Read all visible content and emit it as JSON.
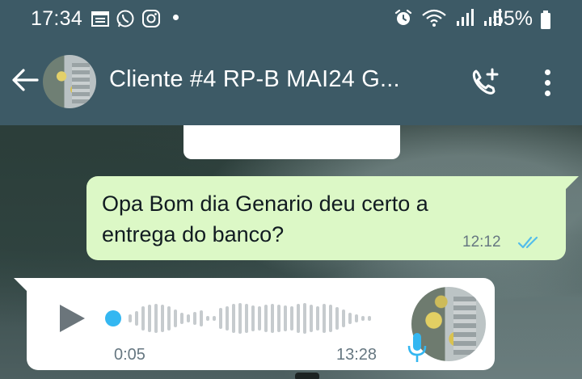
{
  "status_bar": {
    "time": "17:34",
    "battery_percent": "55%",
    "left_icons": [
      "calendar-icon",
      "whatsapp-icon",
      "instagram-icon"
    ],
    "right_icons": [
      "alarm-icon",
      "wifi-icon",
      "signal-icon",
      "signal-icon-2",
      "battery-icon"
    ]
  },
  "header": {
    "contact_name": "Cliente #4 RP-B MAI24 G...",
    "icons": [
      "back-arrow-icon",
      "add-call-icon",
      "more-vert-icon"
    ]
  },
  "messages": {
    "outgoing": {
      "text": "Opa Bom dia Genario deu certo a entrega do banco?",
      "time": "12:12",
      "status": "read"
    },
    "incoming_audio": {
      "duration": "0:05",
      "time": "13:28",
      "progress": 0
    }
  },
  "colors": {
    "header_bg": "#3d5a66",
    "outgoing_bubble": "#dcf8c6",
    "incoming_bubble": "#ffffff",
    "accent_blue": "#34b7f1",
    "read_ticks": "#53bdeb"
  }
}
